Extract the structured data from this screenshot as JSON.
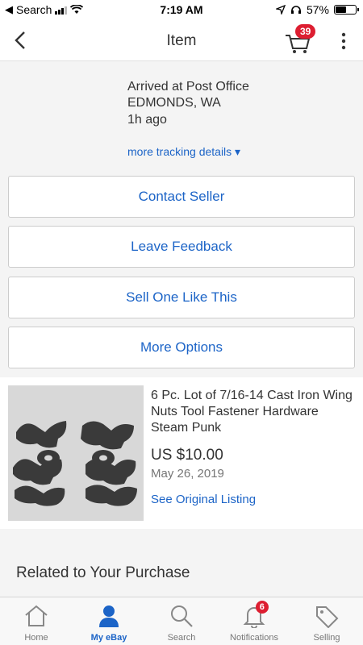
{
  "status_bar": {
    "back_app": "Search",
    "time": "7:19 AM",
    "battery": "57%",
    "battery_level": 0.57
  },
  "header": {
    "title": "Item",
    "cart_count": "39"
  },
  "tracking": {
    "status": "Arrived at Post Office",
    "location": "EDMONDS, WA",
    "time_ago": "1h ago",
    "more_link": "more tracking details ▾"
  },
  "actions": {
    "contact_seller": "Contact Seller",
    "leave_feedback": "Leave Feedback",
    "sell_one": "Sell One Like This",
    "more_options": "More Options"
  },
  "item": {
    "title": "6 Pc. Lot of 7/16-14 Cast Iron Wing Nuts Tool Fastener Hardware Steam Punk",
    "price": "US $10.00",
    "date": "May 26, 2019",
    "listing_link": "See Original Listing"
  },
  "related": {
    "heading": "Related to Your Purchase"
  },
  "tabs": [
    {
      "label": "Home",
      "icon": "home-icon"
    },
    {
      "label": "My eBay",
      "icon": "person-icon"
    },
    {
      "label": "Search",
      "icon": "search-icon"
    },
    {
      "label": "Notifications",
      "icon": "bell-icon",
      "badge": "6"
    },
    {
      "label": "Selling",
      "icon": "tag-icon"
    }
  ],
  "colors": {
    "link_blue": "#1c64c7",
    "badge_red": "#dd1e31"
  }
}
